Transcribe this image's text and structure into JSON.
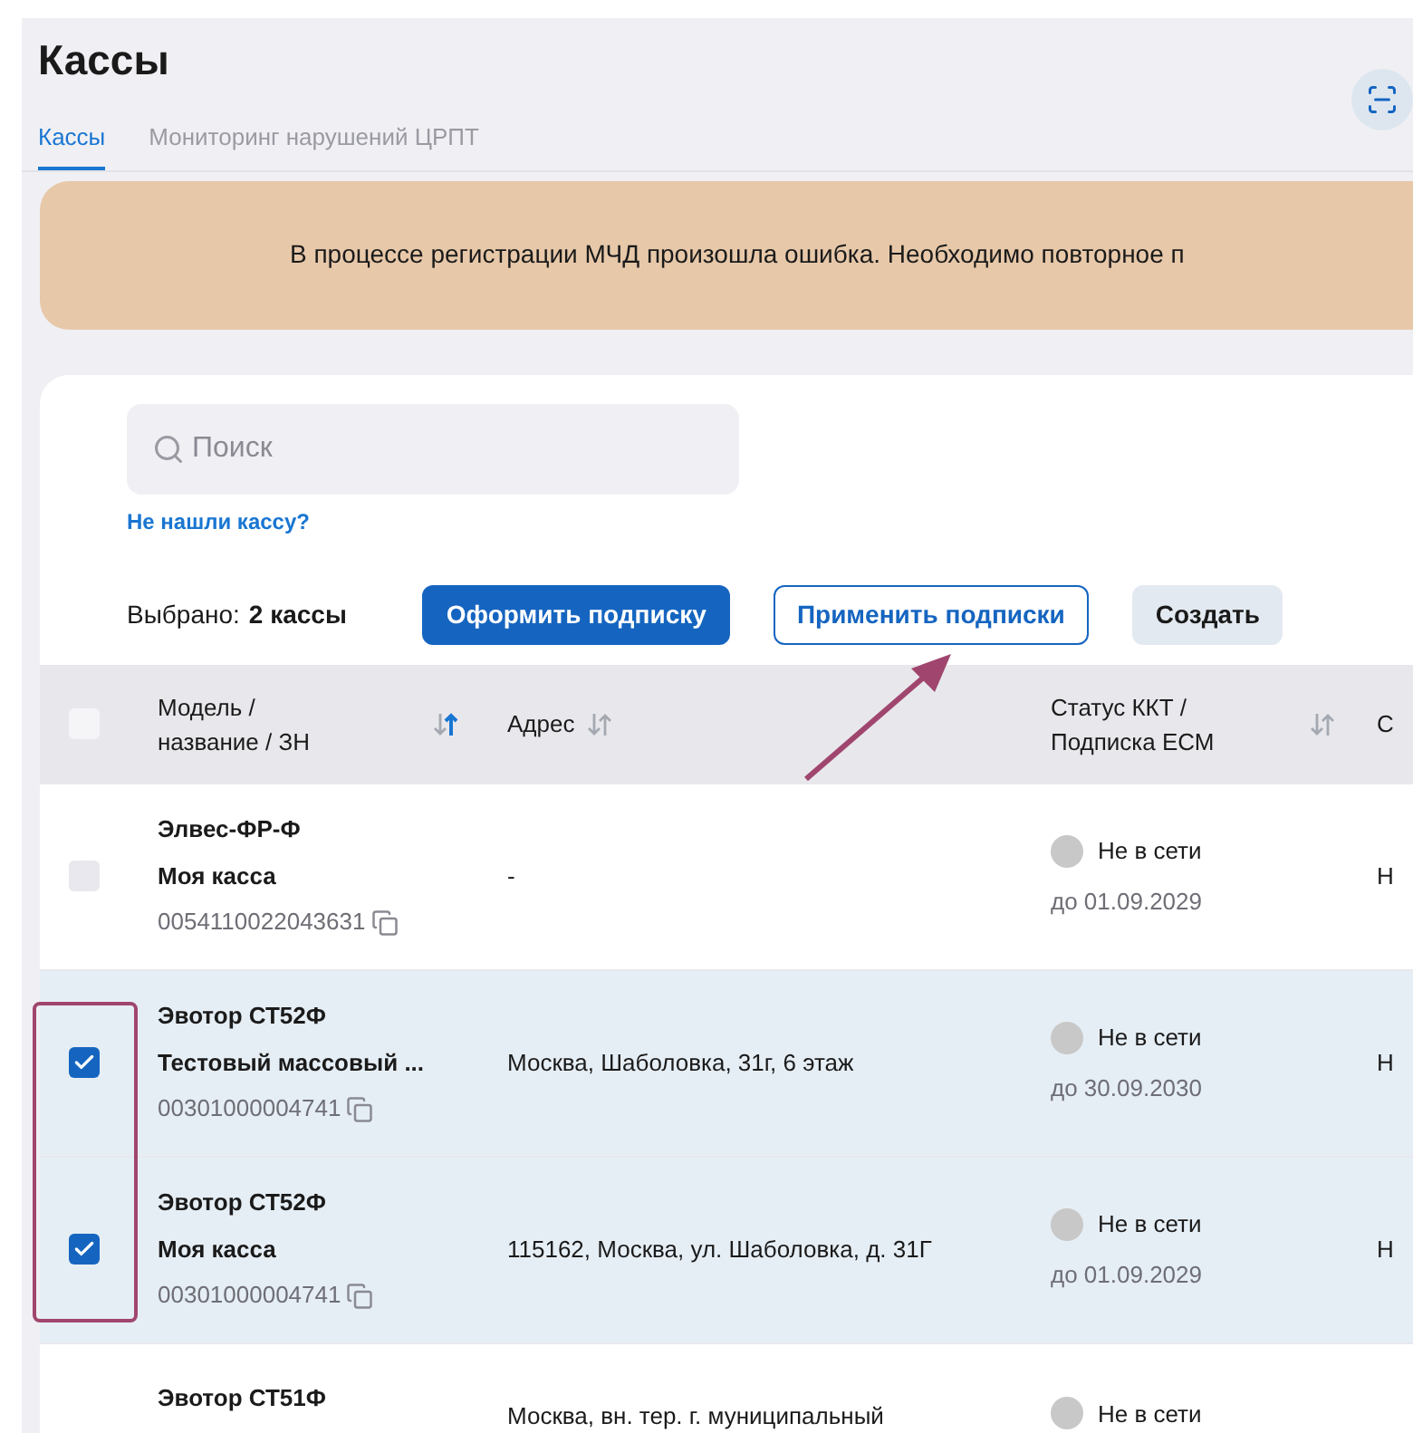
{
  "page": {
    "title": "Кассы"
  },
  "tabs": [
    {
      "label": "Кассы",
      "selected": true
    },
    {
      "label": "Мониторинг нарушений ЦРПТ",
      "selected": false
    }
  ],
  "banner": {
    "text": "В процессе регистрации МЧД произошла ошибка. Необходимо повторное п"
  },
  "search": {
    "placeholder": "Поиск"
  },
  "not_found_link": "Не нашли кассу?",
  "selection": {
    "label": "Выбрано:",
    "count": "2 кассы"
  },
  "buttons": [
    {
      "label": "Оформить подписку",
      "kind": "primary"
    },
    {
      "label": "Применить подписки",
      "kind": "outline"
    },
    {
      "label": "Создать",
      "kind": "secondary"
    }
  ],
  "table": {
    "header_checked": false,
    "columns": [
      {
        "label": "Модель / название / ЗН",
        "sort_active": true
      },
      {
        "label": "Адрес",
        "sort_active": false
      },
      {
        "label": "Статус ККТ / Подписка ЕСМ",
        "sort_active": false
      },
      {
        "label": "С"
      }
    ],
    "rows": [
      {
        "checked": false,
        "model": "Элвес-ФР-Ф",
        "name": "Моя касса",
        "serial": "0054110022043631",
        "address": "-",
        "status": "Не в сети",
        "subscription": "до 01.09.2029",
        "column_4": "Н"
      },
      {
        "checked": true,
        "model": "Эвотор СТ52Ф",
        "name": "Тестовый массовый ...",
        "serial": "00301000004741",
        "address": "Москва, Шаболовка, 31г, 6 этаж",
        "status": "Не в сети",
        "subscription": "до 30.09.2030",
        "column_4": "Н"
      },
      {
        "checked": true,
        "model": "Эвотор СТ52Ф",
        "name": "Моя касса",
        "serial": "00301000004741",
        "address": "115162, Москва, ул. Шаболовка, д. 31Г",
        "status": "Не в сети",
        "subscription": "до 01.09.2029",
        "column_4": "Н"
      },
      {
        "model": "Эвотор СТ51Ф",
        "address": "Москва, вн. тер. г. муниципальный",
        "status": "Не в сети"
      }
    ]
  }
}
